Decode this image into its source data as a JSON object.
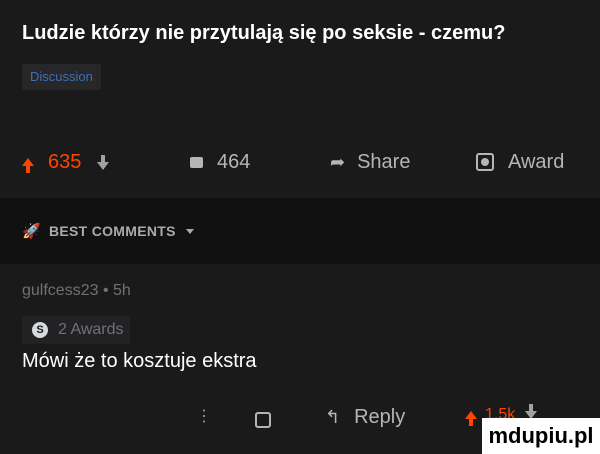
{
  "post": {
    "title": "Ludzie którzy nie przytulają się po seksie - czemu?",
    "flair": "Discussion"
  },
  "actions": {
    "upvotes": "635",
    "comments": "464",
    "share": "Share",
    "award": "Award"
  },
  "comments_header": {
    "label": "BEST COMMENTS"
  },
  "comment": {
    "meta": "gulfcess23 • 5h",
    "awards": "2 Awards",
    "award_badge": "S",
    "text": "Mówi że to kosztuje ekstra",
    "dots": "⋮",
    "reply": "Reply",
    "score": "1.5k"
  },
  "watermark": "mdupiu.pl",
  "colors": {
    "background": "#1a1a1b",
    "upvote": "#ff4500",
    "flair": "#3d6fb6"
  }
}
